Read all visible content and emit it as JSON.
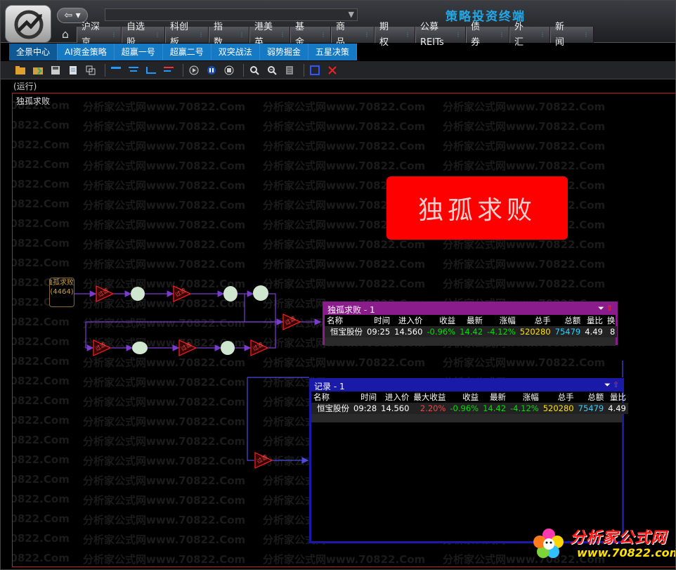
{
  "app": {
    "title": "策略投资终端",
    "back_icon": "arrow-left",
    "home_icon": "home"
  },
  "nav": {
    "items": [
      {
        "label": "沪深京"
      },
      {
        "label": "自选股"
      },
      {
        "label": "科创板"
      },
      {
        "label": "指　数"
      },
      {
        "label": "港美英"
      },
      {
        "label": "基　金"
      },
      {
        "label": "商　品"
      },
      {
        "label": "期　权"
      },
      {
        "label": "公募REITs"
      },
      {
        "label": "债　券"
      },
      {
        "label": "外　汇"
      },
      {
        "label": "新　闻"
      }
    ]
  },
  "subnav": {
    "items": [
      {
        "label": "全景中心",
        "active": true
      },
      {
        "label": "AI资金策略",
        "active": false
      },
      {
        "label": "超赢一号",
        "active": false
      },
      {
        "label": "超赢二号",
        "active": false
      },
      {
        "label": "双突战法",
        "active": false
      },
      {
        "label": "弱势掘金",
        "active": false
      },
      {
        "label": "五星决策",
        "active": false
      }
    ]
  },
  "status": {
    "text": "(运行)"
  },
  "canvas": {
    "title": "独孤求败"
  },
  "watermark": {
    "text": "分析家公式网www.70822.Com",
    "edge_text": "70822.Com"
  },
  "banner": {
    "text": "独孤求败"
  },
  "source_node": {
    "name": "独孤求败",
    "code": "(4464)"
  },
  "node_label": "过滤",
  "panel1": {
    "title": "独孤求败 - 1",
    "headers": [
      "名称",
      "时间",
      "进入价",
      "收益",
      "最新",
      "涨幅",
      "总手",
      "总额",
      "量比",
      "换"
    ],
    "rows": [
      {
        "name": "恒宝股份",
        "time": "09:25",
        "entry": "14.560",
        "gain": "-0.96%",
        "last": "14.42",
        "change": "-4.12%",
        "volume": "520280",
        "amount": "75479",
        "ratio": "4.49",
        "turn": "8"
      }
    ]
  },
  "panel2": {
    "title": "记录 - 1",
    "headers": [
      "名称",
      "时间",
      "进入价",
      "最大收益",
      "收益",
      "最新",
      "涨幅",
      "总手",
      "总额",
      "量比"
    ],
    "rows": [
      {
        "name": "恒宝股份",
        "time": "09:28",
        "entry": "14.560",
        "max_gain": "2.20%",
        "gain": "-0.96%",
        "last": "14.42",
        "change": "-4.12%",
        "volume": "520280",
        "amount": "75479",
        "ratio": "4.49"
      }
    ]
  },
  "colors": {
    "accent": "#1679c4",
    "title": "#23a7e6",
    "banner_bg": "#ff0000",
    "panel1": "#8a1c8c",
    "panel2": "#1a1aa8",
    "negative": "#00e000",
    "positive": "#ff4040",
    "node_fill": "#cfe6cf"
  },
  "site_badge": {
    "title": "分析家公式网",
    "url": "www.70822.com"
  }
}
